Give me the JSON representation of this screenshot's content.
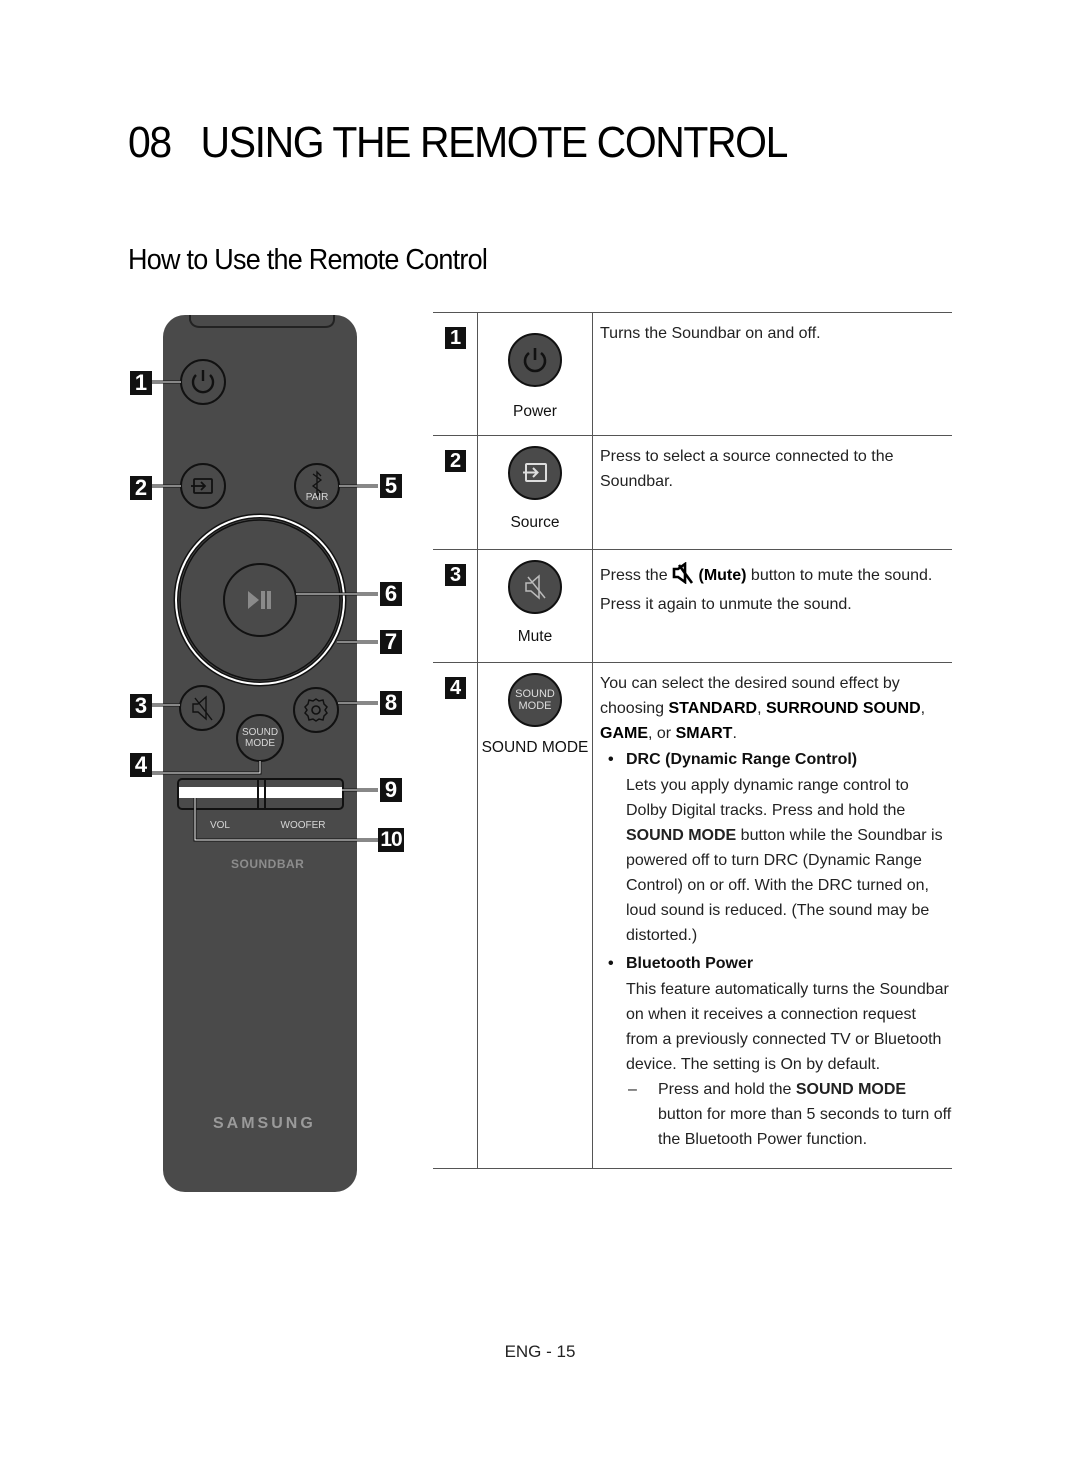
{
  "header": {
    "chapter_number": "08",
    "chapter_title": "USING THE REMOTE CONTROL",
    "section_title": "How to Use the Remote Control"
  },
  "remote": {
    "callouts": [
      "1",
      "2",
      "3",
      "4",
      "5",
      "6",
      "7",
      "8",
      "9",
      "10"
    ],
    "labels": {
      "pair": "PAIR",
      "sound_mode_line1": "SOUND",
      "sound_mode_line2": "MODE",
      "vol": "VOL",
      "woofer": "WOOFER",
      "soundbar": "SOUNDBAR",
      "brand": "SAMSUNG"
    },
    "colors": {
      "body": "#4a4a4a",
      "callout": "#111111"
    }
  },
  "table": {
    "rows": [
      {
        "number": "1",
        "icon": "power-icon",
        "button_name": "Power",
        "description": "Turns the Soundbar on and off."
      },
      {
        "number": "2",
        "icon": "source-icon",
        "button_name": "Source",
        "description_line1": "Press to select a source connected to the",
        "description_line2": "Soundbar."
      },
      {
        "number": "3",
        "icon": "mute-icon",
        "button_name": "Mute",
        "description_pre": "Press the ",
        "description_bold": "(Mute)",
        "description_post": " button to mute the sound.",
        "description_line2": "Press it again to unmute the sound."
      },
      {
        "number": "4",
        "icon": "sound-mode-icon",
        "icon_text_line1": "SOUND",
        "icon_text_line2": "MODE",
        "button_name": "SOUND MODE",
        "intro_pre": "You can select the desired sound effect by choosing ",
        "mode_standard": "STANDARD",
        "sep1": ", ",
        "mode_surround": "SURROUND SOUND",
        "sep2": ", ",
        "mode_game": "GAME",
        "sep3": ", or ",
        "mode_smart": "SMART",
        "end": ".",
        "bullets": [
          {
            "title": "DRC (Dynamic Range Control)",
            "body_pre": "Lets you apply dynamic range control to Dolby Digital tracks. Press and hold the ",
            "body_bold": "SOUND MODE",
            "body_post": " button while the Soundbar is powered off to turn DRC (Dynamic Range Control) on or off. With the DRC turned on, loud sound is reduced. (The sound may be distorted.)"
          },
          {
            "title": "Bluetooth Power",
            "body": "This feature automatically turns the Soundbar on when it receives a connection request from a previously connected TV or Bluetooth device. The setting is On by default.",
            "sub_pre": "Press and hold the ",
            "sub_bold": "SOUND MODE",
            "sub_post": " button for more than 5 seconds to turn off the Bluetooth Power function."
          }
        ]
      }
    ]
  },
  "footer": {
    "page_number": "ENG - 15"
  }
}
